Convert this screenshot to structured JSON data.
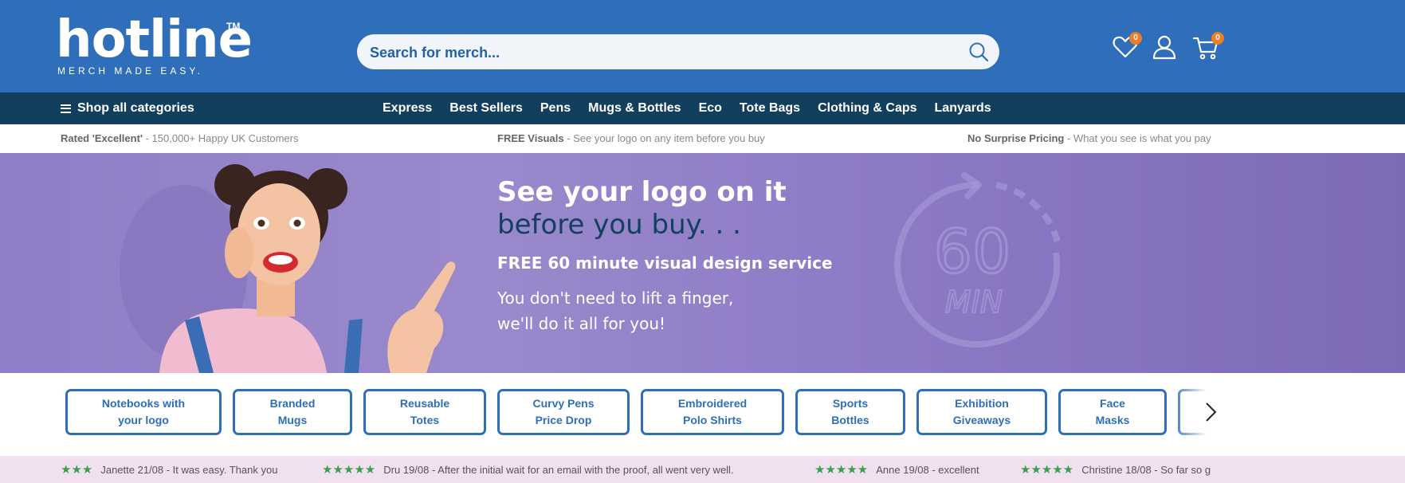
{
  "header": {
    "logo_text": "hotline",
    "logo_tm": "TM",
    "logo_tagline": "MERCH MADE EASY.",
    "search_placeholder": "Search for merch...",
    "wishlist_count": "0",
    "cart_count": "0",
    "colors": {
      "header_bg": "#2f6eb8",
      "badge": "#f07c25"
    },
    "icons": [
      "search-icon",
      "heart-icon",
      "user-icon",
      "cart-icon"
    ]
  },
  "nav": {
    "shop_all": "Shop all categories",
    "links": [
      "Express",
      "Best Sellers",
      "Pens",
      "Mugs & Bottles",
      "Eco",
      "Tote Bags",
      "Clothing & Caps",
      "Lanyards"
    ],
    "colors": {
      "nav_bg": "#133f5f"
    }
  },
  "usp": [
    {
      "bold": "Rated 'Excellent'",
      "text": " - 150,000+ Happy UK Customers"
    },
    {
      "bold": "FREE Visuals",
      "text": " - See your logo on any item before you buy"
    },
    {
      "bold": "No Surprise Pricing",
      "text": " - What you see is what you pay"
    }
  ],
  "hero": {
    "line1": "See your logo on it",
    "line2": "before you buy. . .",
    "line3": "FREE 60 minute visual design service",
    "line4a": "You don't need to lift a finger,",
    "line4b": "we'll do it all for you!",
    "timer_number": "60",
    "timer_unit": "MIN",
    "colors": {
      "hero_bg": "#8f7ec6",
      "accent_text": "#12405f"
    }
  },
  "categories": [
    [
      "Notebooks with",
      "your logo"
    ],
    [
      "Branded",
      "Mugs"
    ],
    [
      "Reusable",
      "Totes"
    ],
    [
      "Curvy Pens",
      "Price Drop"
    ],
    [
      "Embroidered",
      "Polo Shirts"
    ],
    [
      "Sports",
      "Bottles"
    ],
    [
      "Exhibition",
      "Giveaways"
    ],
    [
      "Face",
      "Masks"
    ]
  ],
  "reviews": [
    {
      "stars": "★★★",
      "text": "Janette 21/08 - It was easy. Thank you"
    },
    {
      "stars": "★★★★★",
      "text": "Dru 19/08 - After the initial wait for an email with the proof, all went very well."
    },
    {
      "stars": "★★★★★",
      "text": "Anne 19/08 - excellent"
    },
    {
      "stars": "★★★★★",
      "text": "Christine 18/08 - So far so g"
    }
  ]
}
